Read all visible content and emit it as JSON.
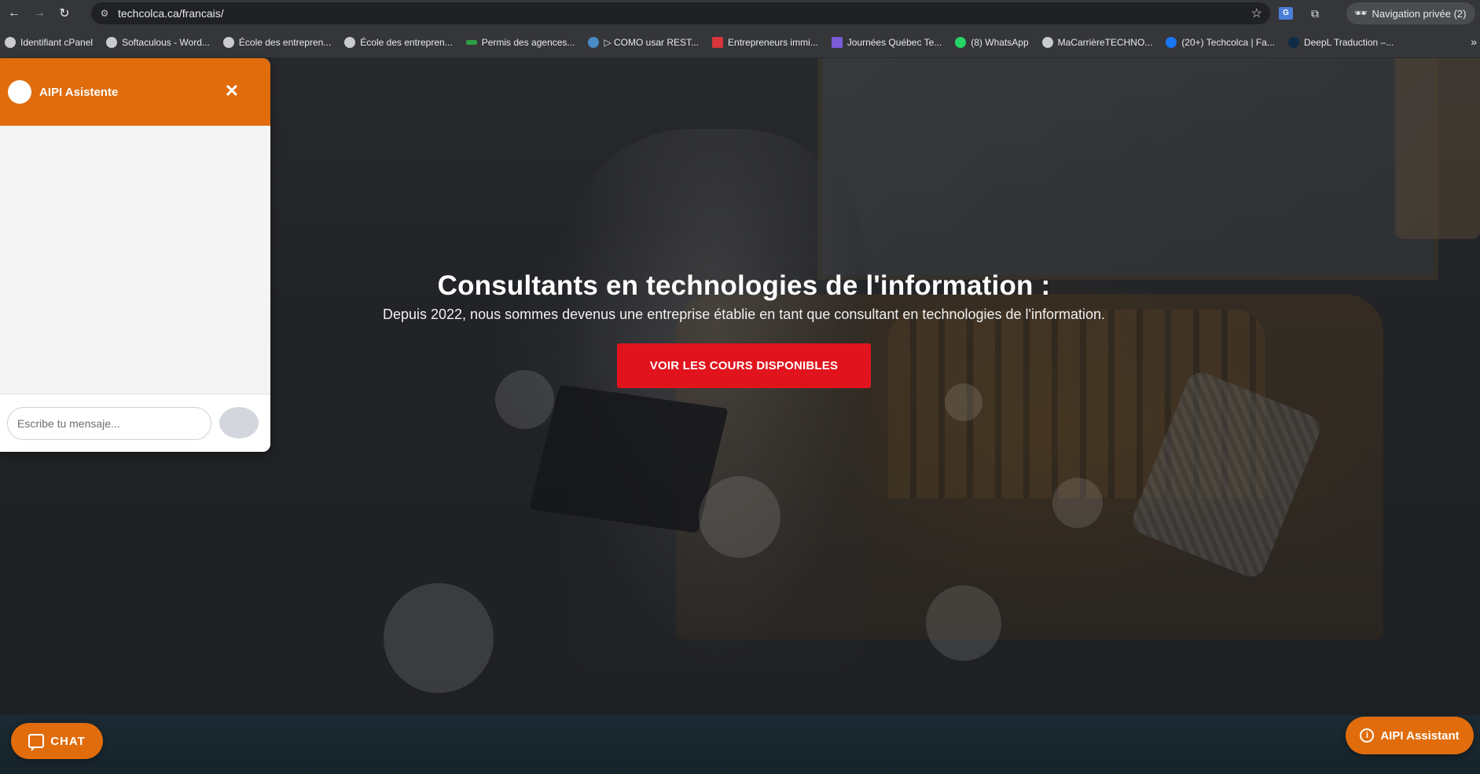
{
  "browser": {
    "url": "techcolca.ca/francais/",
    "private_label": "Navigation privée (2)",
    "translate_icon_text": "G",
    "bookmarks": [
      {
        "label": "Identifiant cPanel",
        "icon": "globe-icon",
        "color": "#c9cbcf"
      },
      {
        "label": "Softaculous - Word...",
        "icon": "globe-icon",
        "color": "#c9cbcf"
      },
      {
        "label": "École des entrepren...",
        "icon": "globe-icon",
        "color": "#c9cbcf"
      },
      {
        "label": "École des entrepren...",
        "icon": "globe-icon",
        "color": "#c9cbcf"
      },
      {
        "label": "Permis des agences...",
        "icon": "green-leaf-icon",
        "color": "#2f9e44"
      },
      {
        "label": "▷ COMO usar REST...",
        "icon": "yt-icon",
        "color": "#4b8ac4"
      },
      {
        "label": "Entrepreneurs immi...",
        "icon": "e-icon",
        "color": "#d8363a"
      },
      {
        "label": "Journées Québec Te...",
        "icon": "play-icon",
        "color": "#7b5cd9"
      },
      {
        "label": "(8) WhatsApp",
        "icon": "whatsapp-icon",
        "color": "#25d366"
      },
      {
        "label": "MaCarrièreTECHNO...",
        "icon": "globe-icon",
        "color": "#c9cbcf"
      },
      {
        "label": "(20+) Techcolca | Fa...",
        "icon": "facebook-icon",
        "color": "#1877f2"
      },
      {
        "label": "DeepL Traduction –...",
        "icon": "deepl-icon",
        "color": "#0f2b46"
      }
    ],
    "bookmarks_more": "»"
  },
  "hero": {
    "title": "Consultants en technologies de l'information :",
    "subtitle": "Depuis 2022, nous sommes devenus une entreprise établie en tant que consultant en technologies de l'information.",
    "cta_label": "VOIR LES COURS DISPONIBLES"
  },
  "chat_widget": {
    "title": "AIPI Asistente",
    "close_glyph": "✕",
    "input_placeholder": "Escribe tu mensaje...",
    "header_color": "#e06c0c"
  },
  "chat_fab": {
    "label": "CHAT"
  },
  "assistant_fab": {
    "label": "AIPI Assistant",
    "icon_glyph": "i"
  },
  "colors": {
    "accent_orange": "#e06c0c",
    "cta_red": "#e1141e"
  }
}
